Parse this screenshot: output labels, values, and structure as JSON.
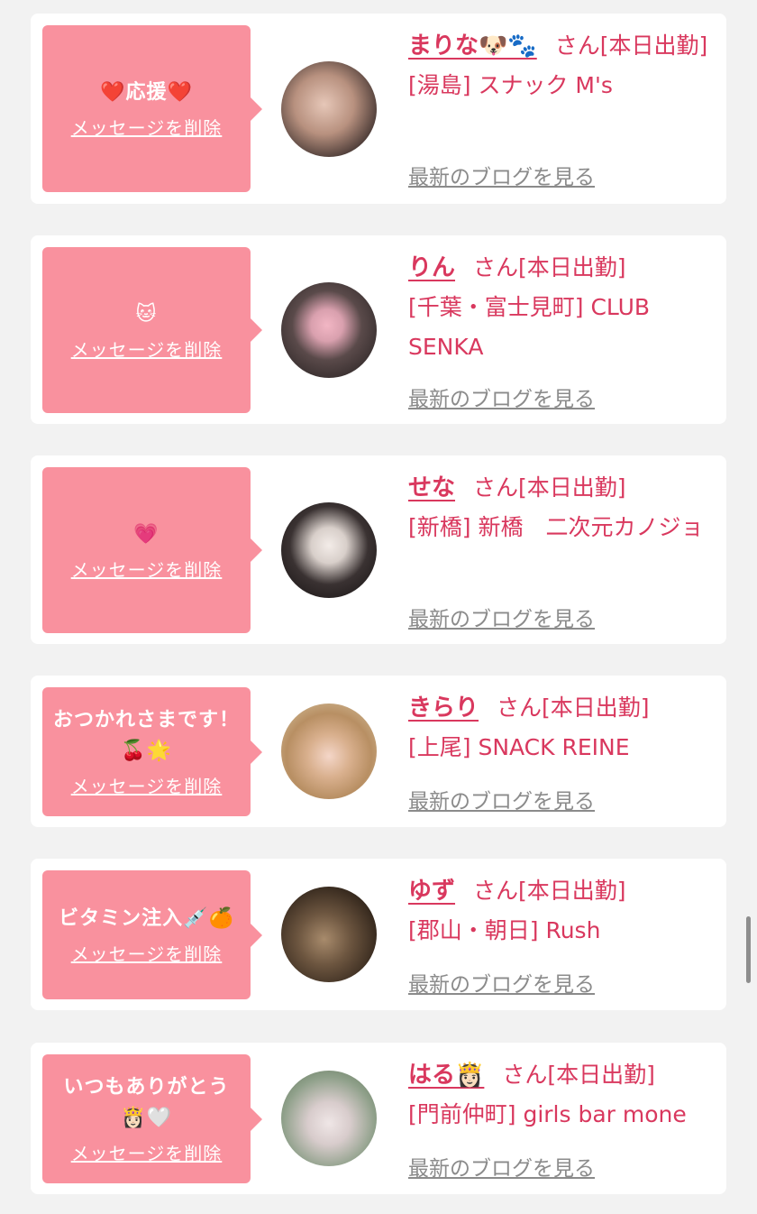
{
  "delete_label": "メッセージを削除",
  "blog_label": "最新のブログを見る",
  "san_label": "さん[本日出勤]",
  "cards": [
    {
      "message": "❤️応援❤️",
      "name": "まりな🐶🐾",
      "shop": "[湯島] スナック M's"
    },
    {
      "message": "🐱",
      "name": "りん",
      "shop": "[千葉・富士見町] CLUB SENKA"
    },
    {
      "message": "💗",
      "name": "せな",
      "shop": "[新橋] 新橋　二次元カノジョ"
    },
    {
      "message": "おつかれさまです！🍒🌟",
      "name": "きらり",
      "shop": "[上尾] SNACK REINE"
    },
    {
      "message": "ビタミン注入💉🍊",
      "name": "ゆず",
      "shop": "[郡山・朝日] Rush"
    },
    {
      "message": "いつもありがとう👸🏻🤍",
      "name": "はる👸🏻",
      "shop": "[門前仲町] girls bar mone"
    }
  ],
  "colors": {
    "bubble": "#f9919e",
    "name": "#d9385e",
    "link": "#8b8b8b",
    "background": "#f2f2f2"
  }
}
